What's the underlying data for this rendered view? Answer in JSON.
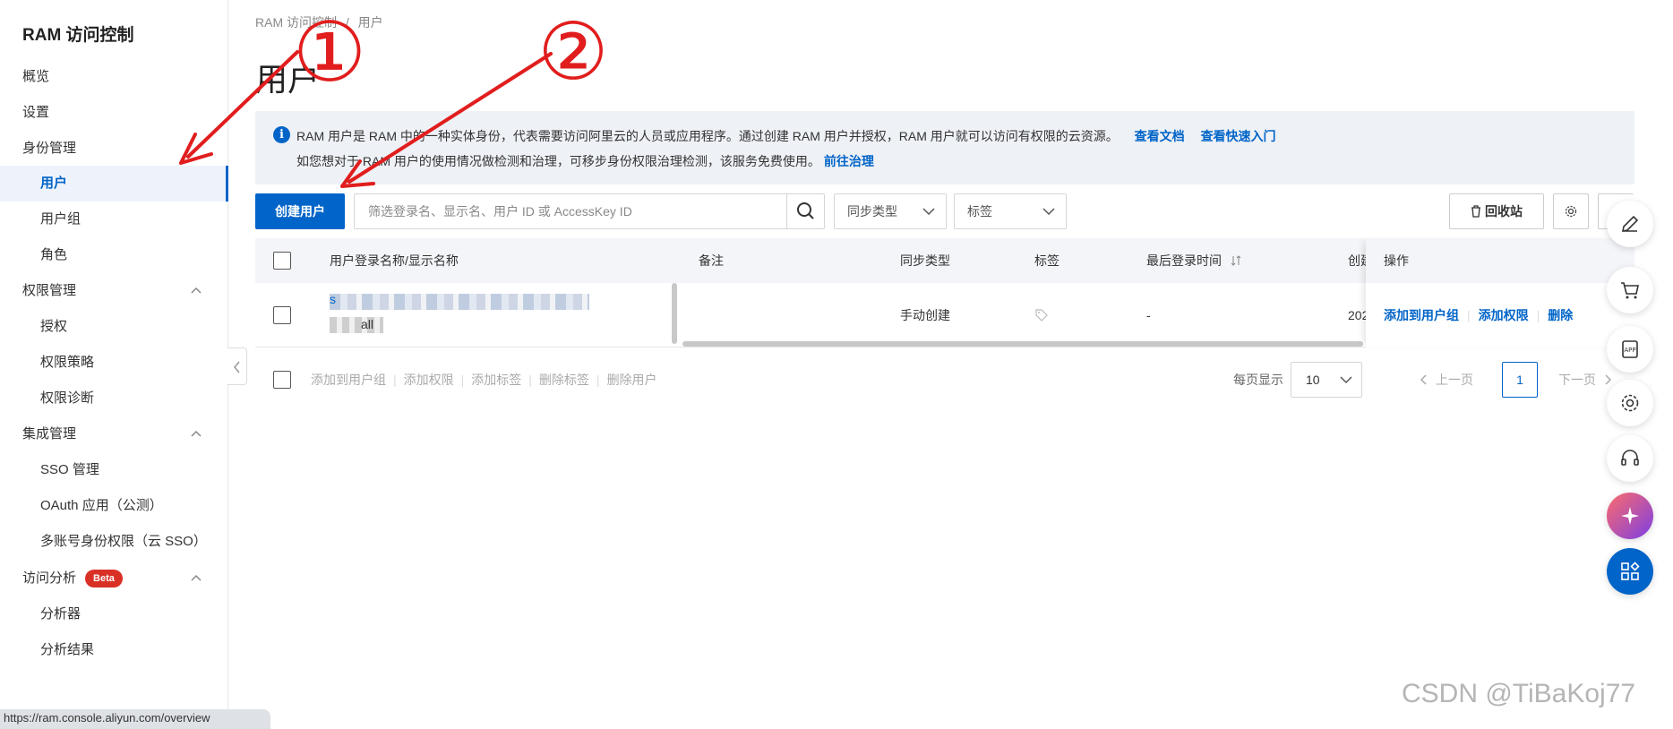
{
  "sidebar": {
    "title": "RAM 访问控制",
    "items": [
      {
        "label": "概览"
      },
      {
        "label": "设置"
      },
      {
        "label": "身份管理"
      },
      {
        "label": "用户"
      },
      {
        "label": "用户组"
      },
      {
        "label": "角色"
      },
      {
        "label": "权限管理"
      },
      {
        "label": "授权"
      },
      {
        "label": "权限策略"
      },
      {
        "label": "权限诊断"
      },
      {
        "label": "集成管理"
      },
      {
        "label": "SSO 管理"
      },
      {
        "label": "OAuth 应用（公测）"
      },
      {
        "label": "多账号身份权限（云 SSO）"
      },
      {
        "label": "访问分析"
      },
      {
        "label": "分析器"
      },
      {
        "label": "分析结果"
      }
    ],
    "beta_badge": "Beta"
  },
  "breadcrumb": {
    "root": "RAM 访问控制",
    "separator": "/",
    "current": "用户"
  },
  "page_title": "用户",
  "info": {
    "line1": "RAM 用户是 RAM 中的一种实体身份，代表需要访问阿里云的人员或应用程序。通过创建 RAM 用户并授权，RAM 用户就可以访问有权限的云资源。",
    "link_docs": "查看文档",
    "link_quickstart": "查看快速入门",
    "line2": "如您想对于 RAM 用户的使用情况做检测和治理，可移步身份权限治理检测，该服务免费使用。",
    "link_govern": "前往治理"
  },
  "toolbar": {
    "create_user": "创建用户",
    "search_placeholder": "筛选登录名、显示名、用户 ID 或 AccessKey ID",
    "sync_type": "同步类型",
    "tag": "标签",
    "recycle_bin": "回收站"
  },
  "table": {
    "columns": [
      "用户登录名称/显示名称",
      "备注",
      "同步类型",
      "标签",
      "最后登录时间",
      "创建",
      "操作"
    ],
    "rows": [
      {
        "name_fragment_1": "s",
        "name_fragment_2": "all",
        "remark": "",
        "sync_type": "手动创建",
        "last_login": "-",
        "created": "202"
      }
    ],
    "row_actions": [
      "添加到用户组",
      "添加权限",
      "删除"
    ]
  },
  "bulk_actions": [
    "添加到用户组",
    "添加权限",
    "添加标签",
    "删除标签",
    "删除用户"
  ],
  "pagination": {
    "per_page_label": "每页显示",
    "per_page": "10",
    "prev": "上一页",
    "current": "1",
    "next": "下一页"
  },
  "annotations": {
    "one": "①",
    "two": "②"
  },
  "status_url": "https://ram.console.aliyun.com/overview",
  "watermark": "CSDN @TiBaKoj77",
  "colors": {
    "accent": "#0064c8",
    "annotation": "#e11d1d",
    "beta": "#d93026"
  }
}
